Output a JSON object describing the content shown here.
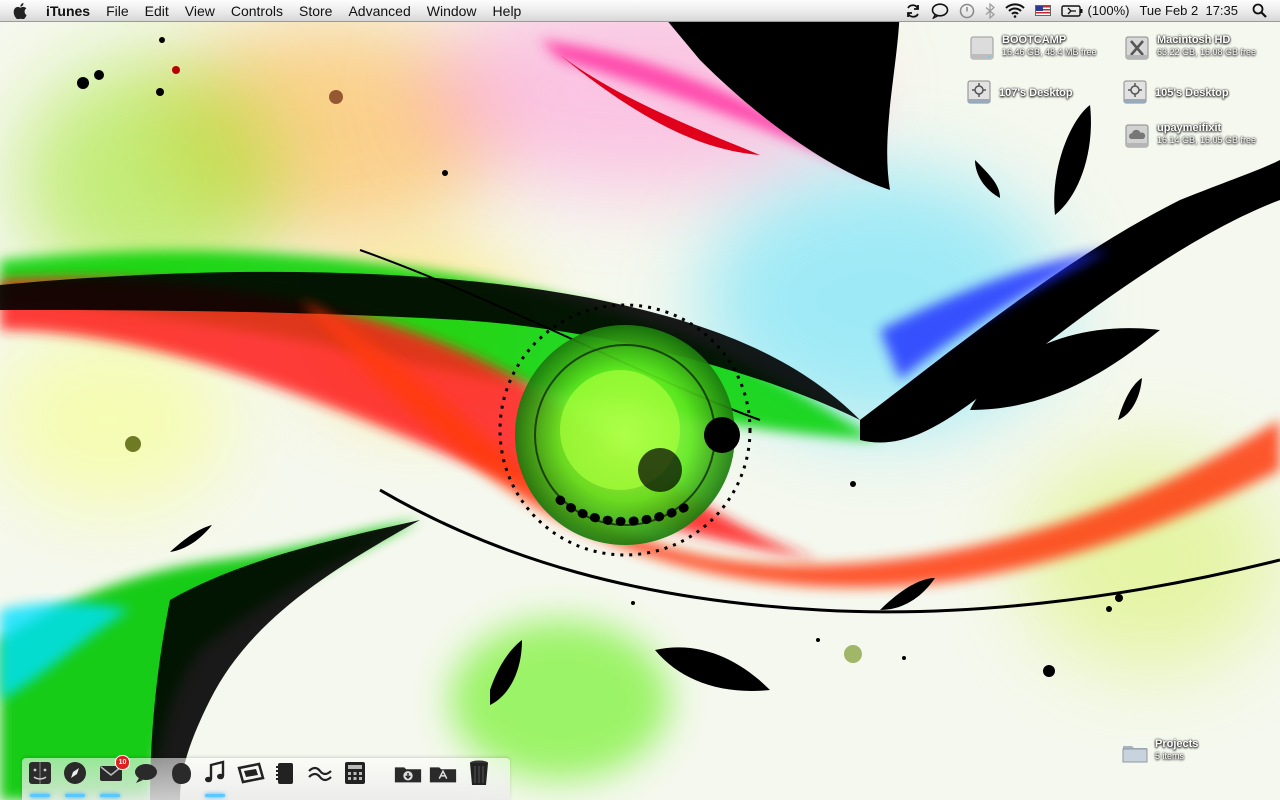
{
  "menubar": {
    "app_name": "iTunes",
    "menus": [
      "File",
      "Edit",
      "View",
      "Controls",
      "Store",
      "Advanced",
      "Window",
      "Help"
    ],
    "status": {
      "battery_percent": "(100%)",
      "clock": "Tue Feb 2  17:35"
    }
  },
  "desktop_icons": {
    "bootcamp": {
      "name": "BOOTCAMP",
      "info": "16.46 GB, 48.4 MB free"
    },
    "macintosh_hd": {
      "name": "Macintosh HD",
      "info": "63.22 GB, 16.08 GB free"
    },
    "desktop_107": {
      "name": "107's Desktop"
    },
    "desktop_105": {
      "name": "105's Desktop"
    },
    "upaymeifixit": {
      "name": "upaymeifixit",
      "info": "16.14 GB, 16.05 GB free"
    },
    "projects": {
      "name": "Projects",
      "info": "5 items"
    }
  },
  "dock": {
    "mail_badge": "10",
    "icons": [
      "finder-icon",
      "safari-icon",
      "mail-icon",
      "ichat-icon",
      "adium-icon",
      "itunes-icon",
      "preview-icon",
      "notebook-icon",
      "textedit-icon",
      "calculator-icon",
      "downloads-folder-icon",
      "applications-folder-icon",
      "trash-icon"
    ]
  },
  "colors": {
    "menubar_top": "#fdfdfd",
    "menubar_bottom": "#d6d6d6",
    "running_indicator": "#5ac8ff",
    "badge": "#e02020"
  }
}
